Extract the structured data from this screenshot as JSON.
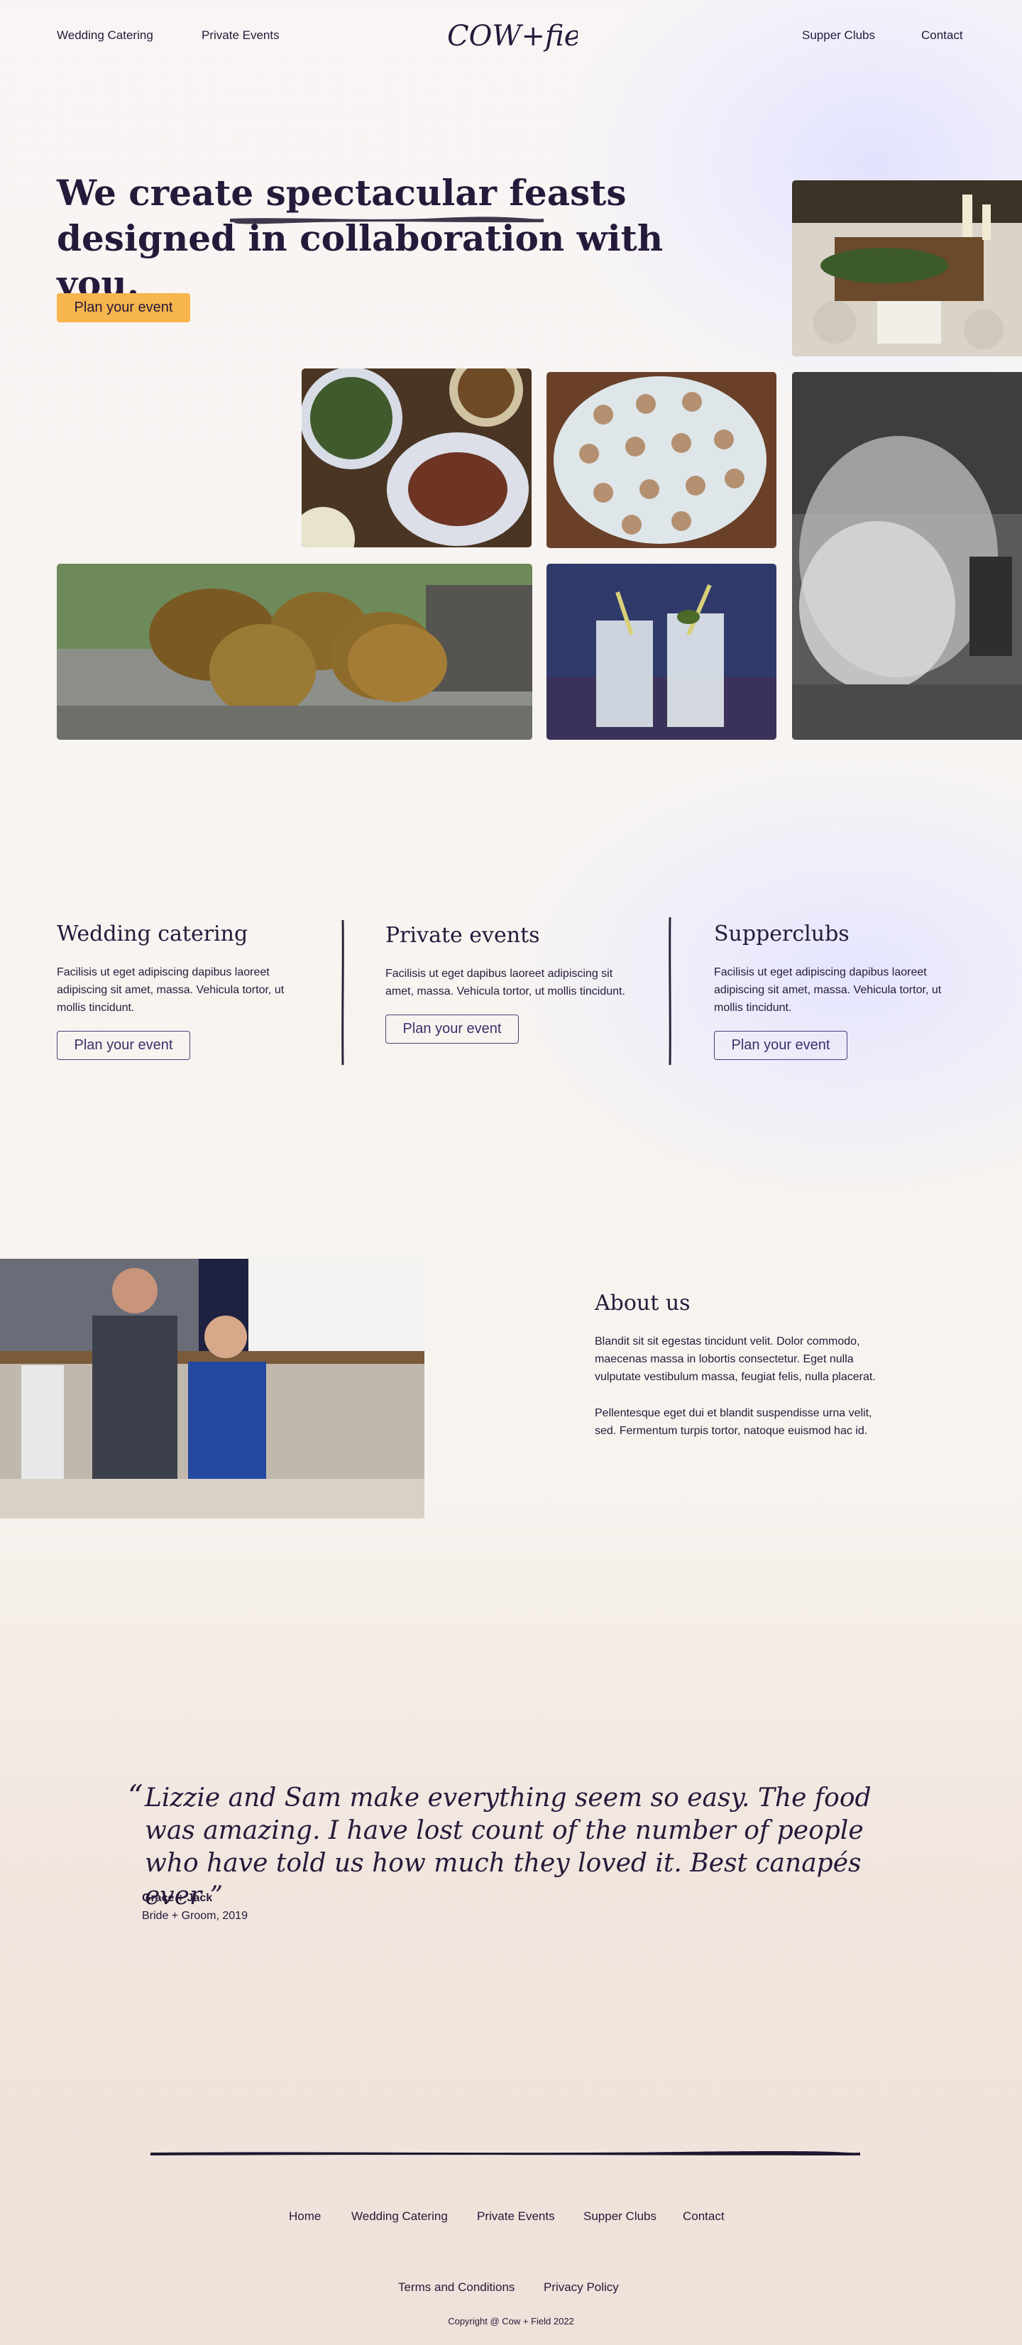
{
  "nav": {
    "left": [
      "Wedding Catering",
      "Private Events"
    ],
    "right": [
      "Supper Clubs",
      "Contact"
    ],
    "logo": "COW+field"
  },
  "hero": {
    "title": "We create spectacular feasts designed in collaboration with you.",
    "cta": "Plan your event",
    "cta_color": "#f7b54d"
  },
  "gallery": {
    "images": [
      "dinner-table-candles",
      "salad-and-steak-plates",
      "canapes-platter",
      "smoke-cooking-bw",
      "roasted-pineapples",
      "cocktail-glasses"
    ]
  },
  "services": [
    {
      "title": "Wedding catering",
      "text": "Facilisis ut eget adipiscing dapibus laoreet adipiscing sit amet, massa. Vehicula tortor, ut mollis tincidunt.",
      "cta": "Plan your event"
    },
    {
      "title": "Private events",
      "text": "Facilisis ut eget   dapibus laoreet adipiscing sit amet, massa. Vehicula tortor, ut mollis tincidunt.",
      "cta": "Plan your event"
    },
    {
      "title": "Supperclubs",
      "text": "Facilisis ut eget adipiscing dapibus laoreet adipiscing sit amet, massa. Vehicula tortor, ut mollis tincidunt.",
      "cta": "Plan your event"
    }
  ],
  "about": {
    "title": "About us",
    "paragraphs": [
      "Blandit sit sit egestas tincidunt velit. Dolor commodo, maecenas massa in lobortis consectetur. Eget nulla vulputate vestibulum massa, feugiat felis, nulla placerat.",
      "Pellentesque eget dui et blandit suspendisse urna velit, sed. Fermentum turpis tortor, natoque euismod hac id."
    ]
  },
  "testimonial": {
    "open_mark": "“",
    "quote": "Lizzie and Sam make everything seem so easy. The food was amazing. I have lost count of the number of people who have told us how much they loved it. Best canapés ever ”",
    "name": "Grace + Jack",
    "role": "Bride + Groom, 2019"
  },
  "footer": {
    "nav": [
      "Home",
      "Wedding Catering",
      "Private Events",
      "Supper Clubs",
      "Contact"
    ],
    "legal": [
      "Terms and Conditions",
      "Privacy Policy"
    ],
    "copyright": "Copyright @ Cow + Field 2022"
  },
  "colors": {
    "text": "#241a3a",
    "accent": "#f7b54d",
    "outline": "#4b3f7a"
  }
}
